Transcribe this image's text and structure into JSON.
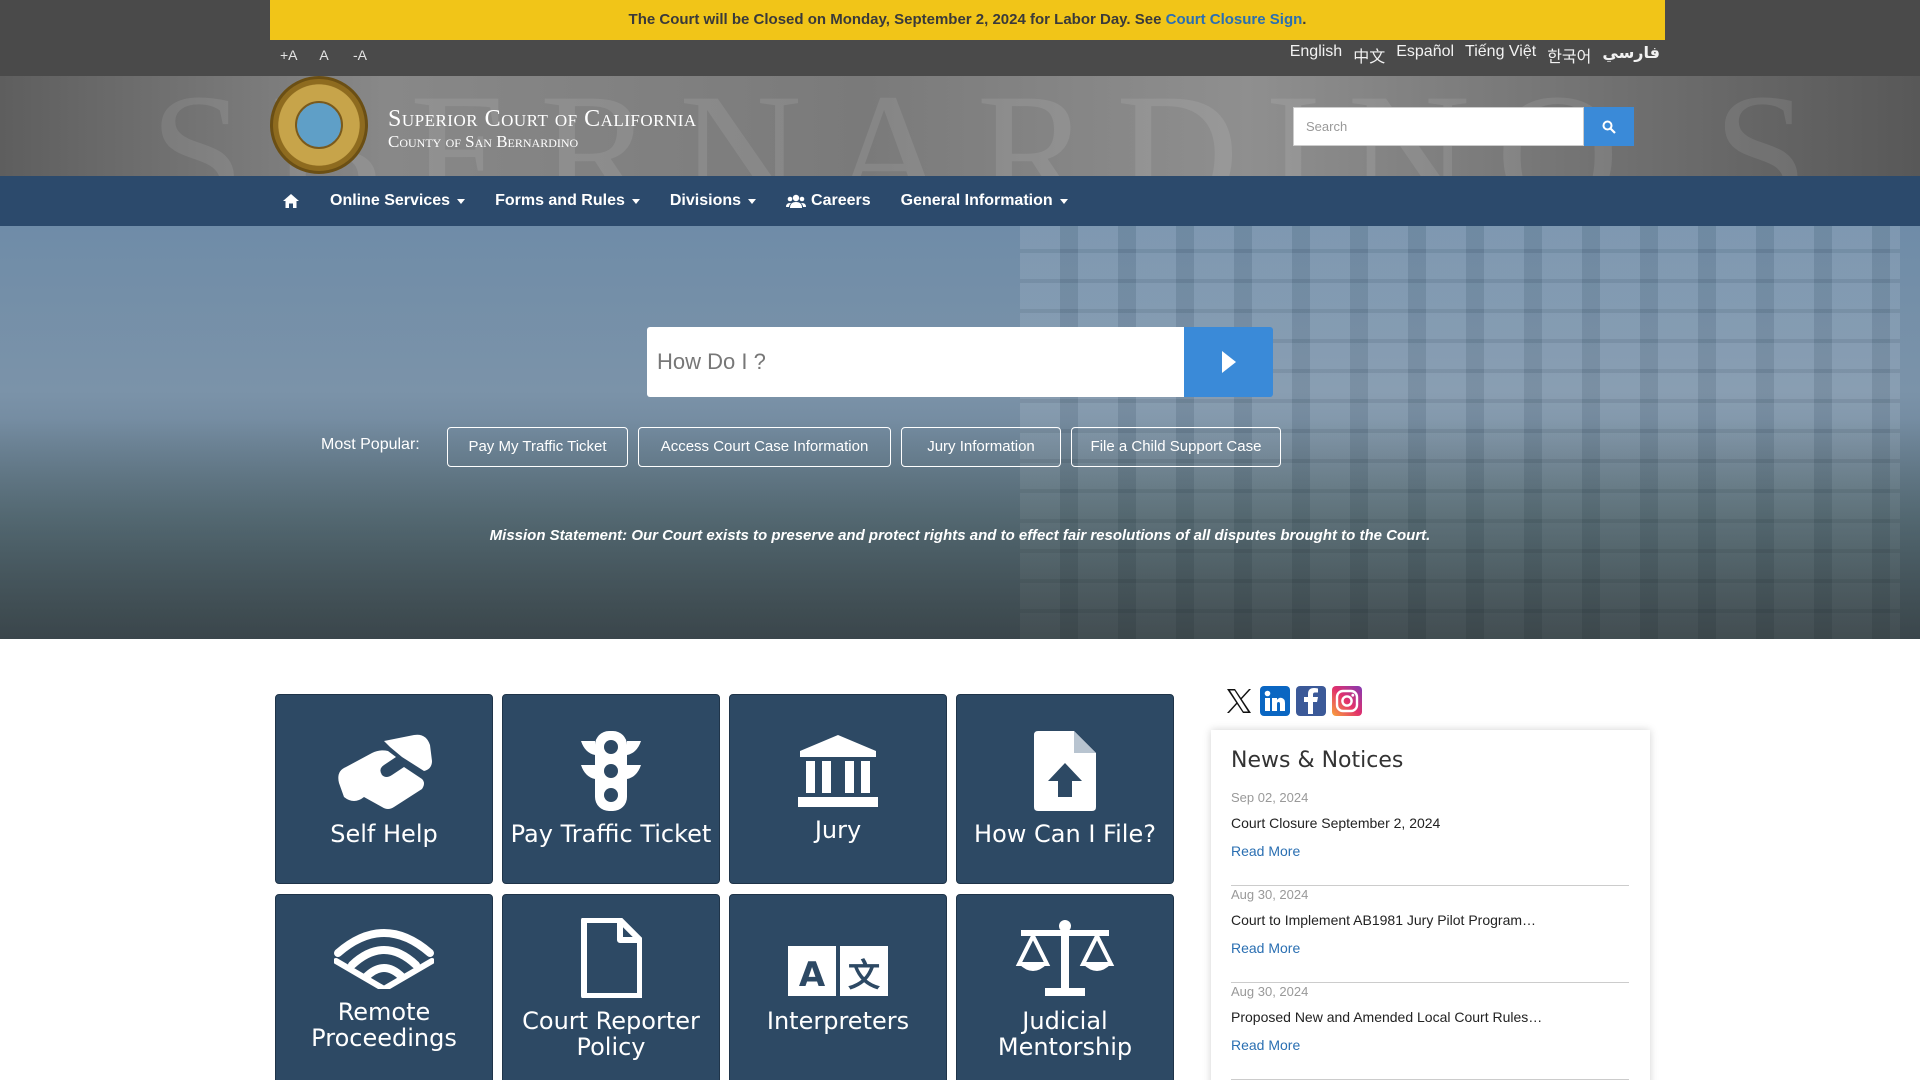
{
  "alert": {
    "text": "The Court will be Closed on Monday, September 2, 2024 for Labor Day. See ",
    "link": "Court Closure Sign",
    "end": "."
  },
  "font_sizer": [
    "+A",
    "A",
    "-A"
  ],
  "languages": [
    "English",
    "中文",
    "Español",
    "Tiếng Việt",
    "한국어",
    "فارسي"
  ],
  "header": {
    "title": "Superior Court of California",
    "subtitle": "County of San Bernardino",
    "search_placeholder": "Search"
  },
  "nav": {
    "items": [
      "Online Services",
      "Forms and Rules",
      "Divisions",
      "Careers",
      "General Information"
    ]
  },
  "hero": {
    "search_placeholder": "How Do I ?",
    "popular_label": "Most Popular:",
    "popular": [
      "Pay My Traffic Ticket",
      "Access Court Case Information",
      "Jury Information",
      "File a Child Support Case"
    ],
    "mission": "Mission Statement: Our Court exists to preserve and protect rights and to effect fair resolutions of all disputes brought to the Court."
  },
  "tiles": [
    {
      "label": "Self Help",
      "icon": "handshake-icon"
    },
    {
      "label": "Pay Traffic Ticket",
      "icon": "traffic-light-icon"
    },
    {
      "label": "Jury",
      "icon": "courthouse-icon"
    },
    {
      "label": "How Can I File?",
      "icon": "file-upload-icon"
    },
    {
      "label": "Remote Proceedings",
      "icon": "wifi-signal-icon"
    },
    {
      "label": "Court Reporter Policy",
      "icon": "document-icon"
    },
    {
      "label": "Interpreters",
      "icon": "language-icon"
    },
    {
      "label": "Judicial Mentorship",
      "icon": "scales-icon"
    }
  ],
  "social": [
    "x-icon",
    "linkedin-icon",
    "facebook-icon",
    "instagram-icon"
  ],
  "news": {
    "heading": "News & Notices",
    "items": [
      {
        "date": "Sep 02, 2024",
        "title": "Court Closure September 2, 2024",
        "more": "Read More"
      },
      {
        "date": "Aug 30, 2024",
        "title": "Court to Implement AB1981 Jury Pilot Program…",
        "more": "Read More"
      },
      {
        "date": "Aug 30, 2024",
        "title": "Proposed New and Amended Local Court Rules…",
        "more": "Read More"
      }
    ]
  },
  "colors": {
    "alert": "#f1c518",
    "nav": "#2c4a6c",
    "tile": "#2d4964",
    "accent": "#3a8ad8",
    "link": "#2a6fb2"
  }
}
